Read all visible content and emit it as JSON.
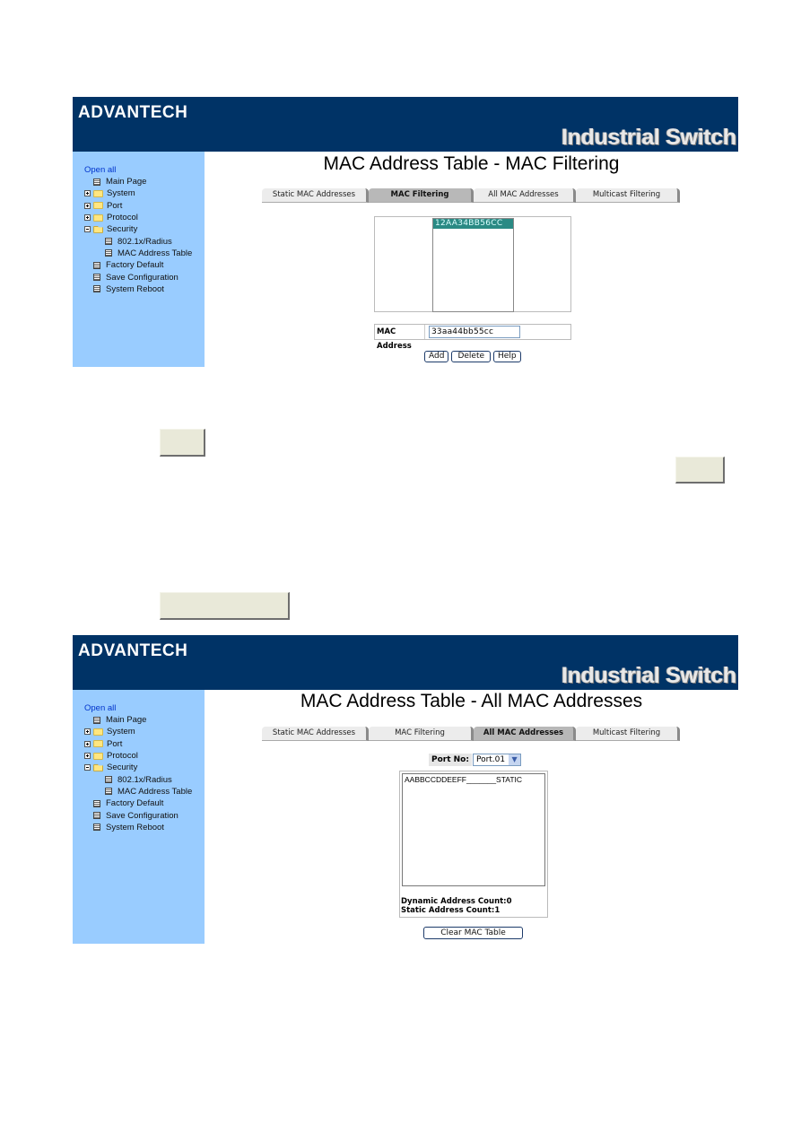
{
  "brand": {
    "logo": "ADVANTECH",
    "product": "Industrial Switch"
  },
  "sidebar": {
    "open_all": "Open all",
    "items": [
      {
        "label": "Main Page",
        "type": "page",
        "level": 0
      },
      {
        "label": "System",
        "type": "folder",
        "state": "collapsed",
        "level": 0
      },
      {
        "label": "Port",
        "type": "folder",
        "state": "collapsed",
        "level": 0
      },
      {
        "label": "Protocol",
        "type": "folder",
        "state": "collapsed",
        "level": 0
      },
      {
        "label": "Security",
        "type": "folder",
        "state": "expanded",
        "level": 0
      },
      {
        "label": "802.1x/Radius",
        "type": "page",
        "level": 1
      },
      {
        "label": "MAC Address Table",
        "type": "page",
        "level": 1
      },
      {
        "label": "Factory Default",
        "type": "page",
        "level": 0
      },
      {
        "label": "Save Configuration",
        "type": "page",
        "level": 0
      },
      {
        "label": "System Reboot",
        "type": "page",
        "level": 0
      }
    ]
  },
  "tabs": [
    {
      "label": "Static MAC Addresses"
    },
    {
      "label": "MAC Filtering"
    },
    {
      "label": "All MAC Addresses"
    },
    {
      "label": "Multicast Filtering"
    }
  ],
  "screen1": {
    "title": "MAC Address Table - MAC Filtering",
    "active_tab": "MAC Filtering",
    "filter_list": [
      "12AA34BB56CC"
    ],
    "selected_entry": "12AA34BB56CC",
    "mac_address_label": "MAC Address",
    "mac_address_value": "33aa44bb55cc",
    "buttons": {
      "add": "Add",
      "delete": "Delete",
      "help": "Help"
    }
  },
  "screen2": {
    "title": "MAC Address Table - All MAC Addresses",
    "active_tab": "All MAC Addresses",
    "port_label": "Port No:",
    "port_value": "Port.01",
    "entries": [
      "AABBCCDDEEFF_______STATIC"
    ],
    "dynamic_count_label": "Dynamic Address Count:",
    "dynamic_count": "0",
    "static_count_label": "Static Address Count:",
    "static_count": "1",
    "clear_button": "Clear MAC Table"
  },
  "colors": {
    "banner": "#003366",
    "sidebar": "#99ccff",
    "selection": "#2a8a84",
    "tab_active": "#b8b8b8"
  }
}
